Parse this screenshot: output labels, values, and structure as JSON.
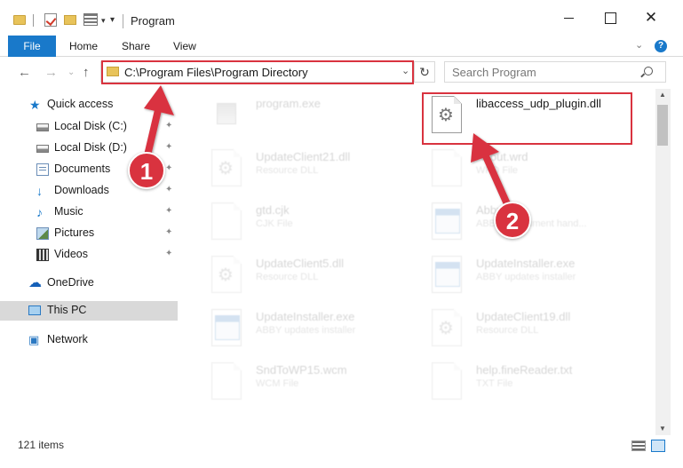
{
  "window": {
    "title": "Program",
    "minimize_icon": "minimize-icon",
    "maximize_icon": "maximize-icon",
    "close_glyph": "✕"
  },
  "ribbon": {
    "tabs": [
      "File",
      "Home",
      "Share",
      "View"
    ],
    "help_label": "?"
  },
  "nav": {
    "address": "C:\\Program Files\\Program Directory",
    "search_placeholder": "Search Program",
    "refresh_glyph": "↻",
    "back_glyph": "←",
    "forward_glyph": "→",
    "up_glyph": "↑",
    "recent_glyph": "⌄",
    "addr_dropdown_glyph": "⌄"
  },
  "sidebar": {
    "items": [
      {
        "label": "Quick access",
        "icon": "star-icon"
      },
      {
        "label": "Local Disk (C:)",
        "icon": "drive-icon"
      },
      {
        "label": "Local Disk (D:)",
        "icon": "drive-icon"
      },
      {
        "label": "Documents",
        "icon": "documents-icon"
      },
      {
        "label": "Downloads",
        "icon": "downloads-icon"
      },
      {
        "label": "Music",
        "icon": "music-icon"
      },
      {
        "label": "Pictures",
        "icon": "pictures-icon"
      },
      {
        "label": "Videos",
        "icon": "videos-icon"
      },
      {
        "label": "OneDrive",
        "icon": "onedrive-icon"
      },
      {
        "label": "This PC",
        "icon": "this-pc-icon"
      },
      {
        "label": "Network",
        "icon": "network-icon"
      }
    ],
    "pin_glyph": "📌"
  },
  "files": [
    {
      "name": "program.exe",
      "type": ""
    },
    {
      "name": "libaccess_udp_plugin.dll",
      "type": ""
    },
    {
      "name": "UpdateClient21.dll",
      "type": "Resource DLL"
    },
    {
      "name": "About.wrd",
      "type": "WRD File"
    },
    {
      "name": "gtd.cjk",
      "type": "CJK File"
    },
    {
      "name": "Abby.exe",
      "type": "ABBYY document hand..."
    },
    {
      "name": "UpdateClient5.dll",
      "type": "Resource DLL"
    },
    {
      "name": "UpdateInstaller.exe",
      "type": "ABBY updates installer"
    },
    {
      "name": "UpdateInstaller.exe",
      "type": "ABBY updates installer"
    },
    {
      "name": "UpdateClient19.dll",
      "type": "Resource DLL"
    },
    {
      "name": "SndToWP15.wcm",
      "type": "WCM File"
    },
    {
      "name": "help.fineReader.txt",
      "type": "TXT File"
    }
  ],
  "status": {
    "item_count": "121 items"
  },
  "annotations": {
    "step1": "1",
    "step2": "2",
    "highlight_color": "#d9333f"
  }
}
